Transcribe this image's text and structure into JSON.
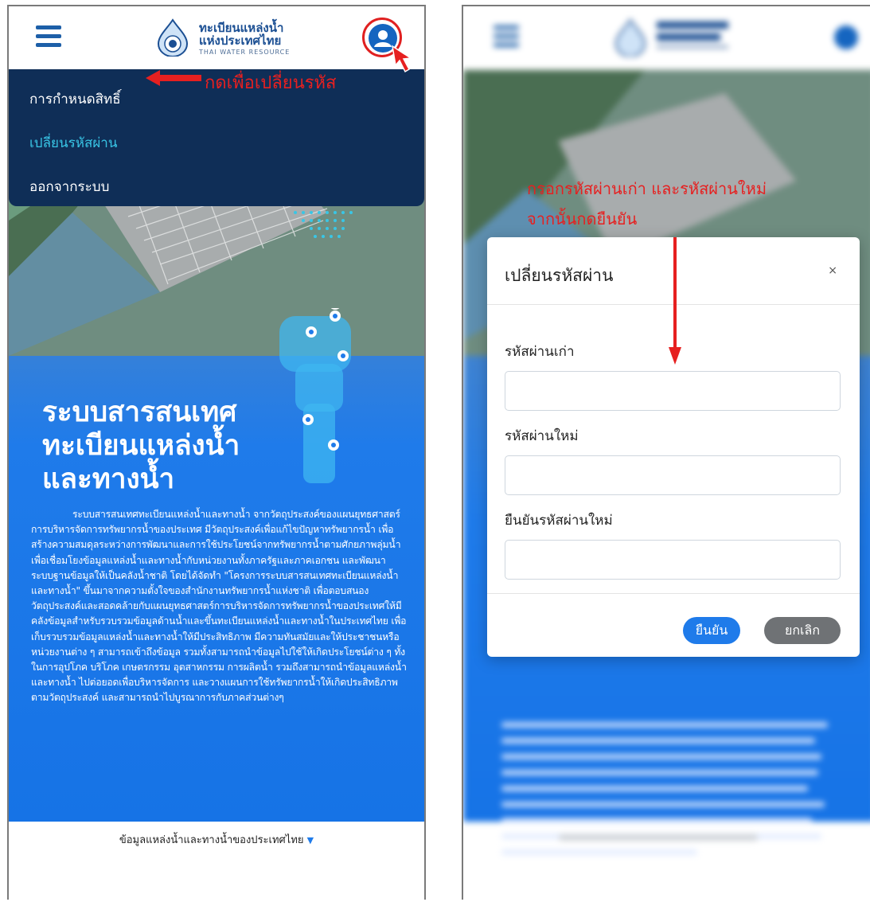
{
  "brand": {
    "line1": "ทะเบียนแหล่งน้ำ",
    "line2": "แห่งประเทศไทย",
    "line3": "THAI WATER RESOURCE"
  },
  "menu": {
    "items": [
      {
        "label": "การกำหนดสิทธิ์",
        "active": false
      },
      {
        "label": "เปลี่ยนรหัสผ่าน",
        "active": true
      },
      {
        "label": "ออกจากระบบ",
        "active": false
      }
    ]
  },
  "annotations": {
    "menu_hint": "กดเพื่อเปลี่ยนรหัส",
    "dialog_hint_line1": "กรอกรหัสผ่านเก่า และรหัสผ่านใหม่",
    "dialog_hint_line2": "จากนั้นกดยืนยัน"
  },
  "hero": {
    "title_lines": [
      "ระบบสารสนเทศ",
      "ทะเบียนแหล่งน้ำ",
      "และทางน้ำ"
    ],
    "paragraph": "ระบบสารสนเทศทะเบียนแหล่งน้ำและทางน้ำ จากวัตถุประสงค์ของแผนยุทธศาสตร์การบริหารจัดการทรัพยากรน้ำของประเทศ มีวัตถุประสงค์เพื่อแก้ไขปัญหาทรัพยากรน้ำ เพื่อสร้างความสมดุลระหว่างการพัฒนาและการใช้ประโยชน์จากทรัพยากรน้ำตามศักยภาพลุ่มน้ำ เพื่อเชื่อมโยงข้อมูลแหล่งน้ำและทางน้ำกับหน่วยงานทั้งภาครัฐและภาคเอกชน และพัฒนาระบบฐานข้อมูลให้เป็นคลังน้ำชาติ โดยได้จัดทำ \"โครงการระบบสารสนเทศทะเบียนแหล่งน้ำและทางน้ำ\" ขึ้นมาจากความตั้งใจของสำนักงานทรัพยากรน้ำแห่งชาติ เพื่อตอบสนองวัตถุประสงค์และสอดคล้ายกับแผนยุทธศาสตร์การบริหารจัดการทรัพยากรน้ำของประเทศให้มีคลังข้อมูลสำหรับรวบรวมข้อมูลด้านน้ำและขึ้นทะเบียนแหล่งน้ำและทางน้ำในประเทศไทย เพื่อเก็บรวบรวมข้อมูลแหล่งน้ำและทางน้ำให้มีประสิทธิภาพ มีความทันสมัยและให้ประชาชนหรือหน่วยงานต่าง ๆ สามารถเข้าถึงข้อมูล รวมทั้งสามารถนำข้อมูลไปใช้ให้เกิดประโยชน์ต่าง ๆ ทั้งในการอุปโภค บริโภค เกษตรกรรม อุตสาหกรรม การผลิตน้ำ รวมถึงสามารถนำข้อมูลแหล่งน้ำและทางน้ำ ไปต่อยอดเพื่อบริหารจัดการ และวางแผนการใช้ทรัพยากรน้ำให้เกิดประสิทธิภาพตามวัตถุประสงค์ และสามารถนำไปบูรณาการกับภาคส่วนต่างๆ"
  },
  "footer": {
    "link_label": "ข้อมูลแหล่งน้ำและทางน้ำของประเทศไทย"
  },
  "dialog": {
    "title": "เปลี่ยนรหัสผ่าน",
    "close": "×",
    "fields": [
      {
        "label": "รหัสผ่านเก่า",
        "value": ""
      },
      {
        "label": "รหัสผ่านใหม่",
        "value": ""
      },
      {
        "label": "ยืนยันรหัสผ่านใหม่",
        "value": ""
      }
    ],
    "confirm_label": "ยืนยัน",
    "cancel_label": "ยกเลิก"
  },
  "colors": {
    "header_brand": "#1b4f93",
    "menu_bg": "#0f2e57",
    "menu_active": "#39c6e6",
    "accent_blue": "#1f7bea",
    "annotation_red": "#e62020",
    "cancel_gray": "#6f7275"
  },
  "icons": [
    "hamburger-icon",
    "thai-seal-logo",
    "user-avatar-icon",
    "caret-down-icon",
    "close-icon"
  ]
}
